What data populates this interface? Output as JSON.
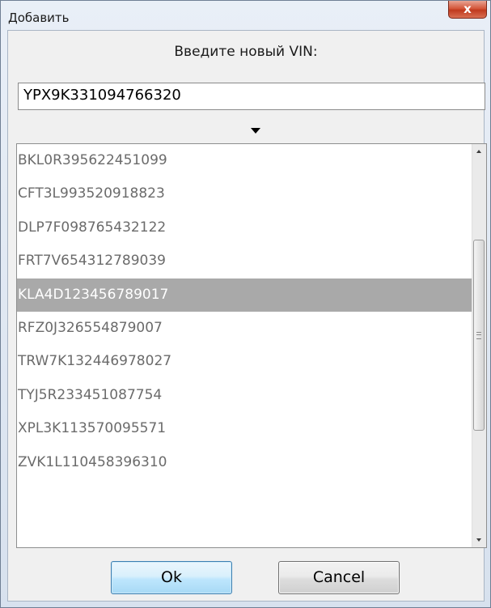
{
  "window": {
    "title": "Добавить",
    "close_glyph": "x"
  },
  "dialog": {
    "prompt": "Введите новый VIN:",
    "vin_value": "YPX9K331094766320",
    "dropdown_icon": "caret-down-icon"
  },
  "list": {
    "items": [
      "BKL0R395622451099",
      "CFT3L993520918823",
      "DLP7F098765432122",
      "FRT7V654312789039",
      "KLA4D123456789017",
      "RFZ0J326554879007",
      "TRW7K132446978027",
      "TYJ5R233451087754",
      "XPL3K113570095571",
      "ZVK1L110458396310"
    ],
    "selected_index": 4
  },
  "buttons": {
    "ok_label": "Ok",
    "cancel_label": "Cancel"
  },
  "colors": {
    "selection": "#a9a9a9",
    "item_text": "#6b6b6b",
    "close_button": "#c03a1e",
    "ok_button": "#bee6fd"
  }
}
